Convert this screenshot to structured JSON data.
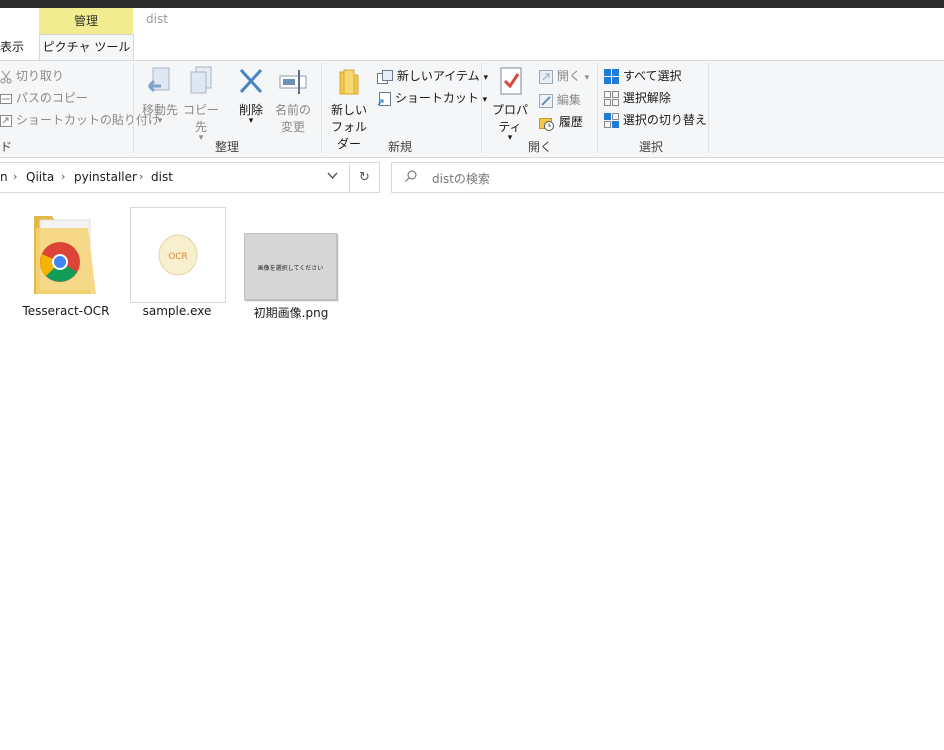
{
  "window": {
    "context_tab_header": "管理",
    "context_tab": "ピクチャ ツール",
    "left_tab": "表示",
    "title": "dist"
  },
  "ribbon": {
    "clipboard": {
      "cut": "切り取り",
      "copy_path": "パスのコピー",
      "paste_shortcut": "ショートカットの貼り付け",
      "group_label": "ド"
    },
    "organize": {
      "move_to": "移動先",
      "copy_to": "コピー先",
      "delete": "削除",
      "rename_line1": "名前の",
      "rename_line2": "変更",
      "group_label": "整理"
    },
    "new": {
      "new_folder_line1": "新しい",
      "new_folder_line2": "フォルダー",
      "new_item": "新しいアイテム",
      "shortcut": "ショートカット",
      "group_label": "新規"
    },
    "open": {
      "properties": "プロパティ",
      "open": "開く",
      "edit": "編集",
      "history": "履歴",
      "group_label": "開く"
    },
    "select": {
      "select_all": "すべて選択",
      "select_none": "選択解除",
      "invert": "選択の切り替え",
      "group_label": "選択"
    }
  },
  "address": {
    "crumbs": [
      "n",
      "Qiita",
      "pyinstaller",
      "dist"
    ],
    "search_placeholder": "distの検索"
  },
  "files": [
    {
      "name": "Tesseract-OCR",
      "type": "folder"
    },
    {
      "name": "sample.exe",
      "type": "exe",
      "icon_text": "OCR"
    },
    {
      "name": "初期画像.png",
      "type": "png",
      "thumb_text": "画像を選択してください"
    }
  ],
  "colors": {
    "context_tab": "#f0ec8f",
    "ribbon_bg": "#f5f6f7",
    "accent_blue": "#1e7bd6"
  }
}
